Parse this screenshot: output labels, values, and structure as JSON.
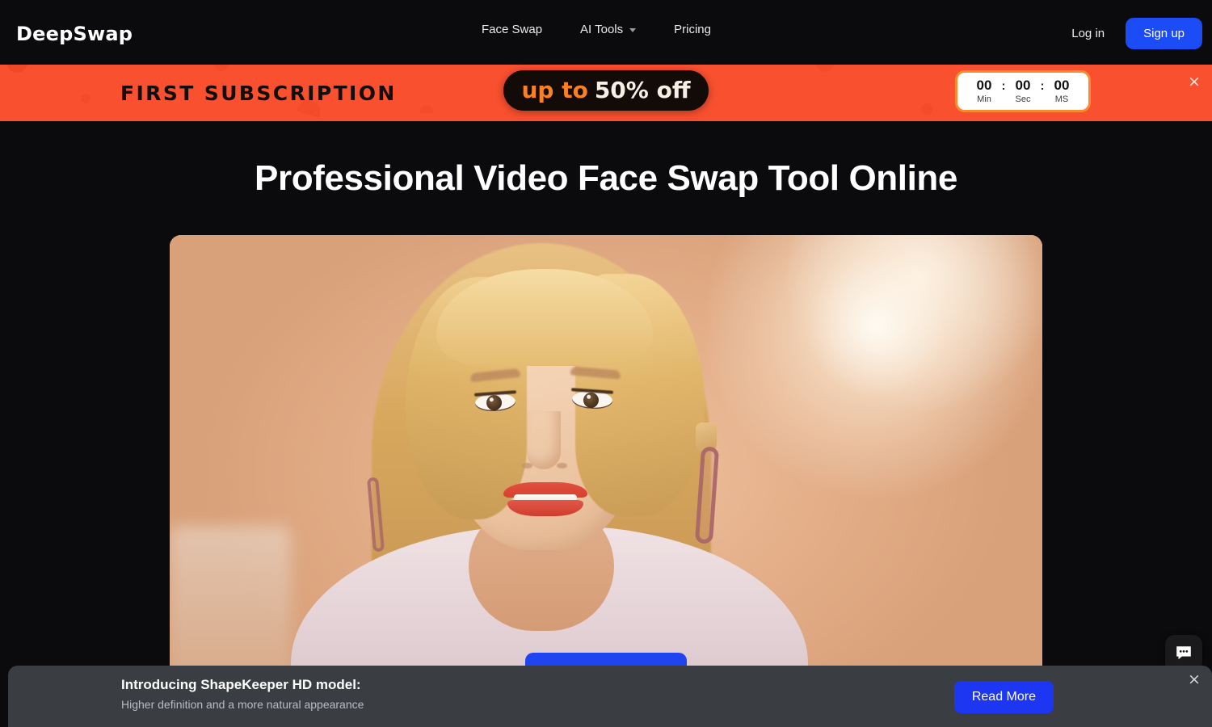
{
  "header": {
    "logo": "DeepSwap",
    "nav": [
      {
        "label": "Face Swap",
        "has_dropdown": false
      },
      {
        "label": "AI Tools",
        "has_dropdown": true
      },
      {
        "label": "Pricing",
        "has_dropdown": false
      }
    ],
    "login_label": "Log in",
    "signup_label": "Sign up"
  },
  "promo_banner": {
    "title": "FIRST SUBSCRIPTION",
    "offer_prefix": "up to",
    "offer_amount": "50% off",
    "countdown": {
      "minutes": "00",
      "seconds": "00",
      "milliseconds": "00",
      "separator": ":",
      "label_minutes": "Min",
      "label_seconds": "Sec",
      "label_milliseconds": "MS"
    },
    "close_icon": "×",
    "background_color": "#F9502F",
    "pill_background": "#120B08",
    "offer_prefix_color": "#F98124"
  },
  "hero": {
    "title": "Professional Video Face Swap Tool Online",
    "cta_label": "",
    "cta_color": "#2044F0"
  },
  "chat": {
    "icon": "chat-bubble-icon"
  },
  "notice": {
    "title": "Introducing ShapeKeeper HD model:",
    "subtitle": "Higher definition and a more natural appearance",
    "button_label": "Read More",
    "close_icon": "×",
    "background_color": "#3A3D42",
    "button_color": "#1C36F2"
  }
}
